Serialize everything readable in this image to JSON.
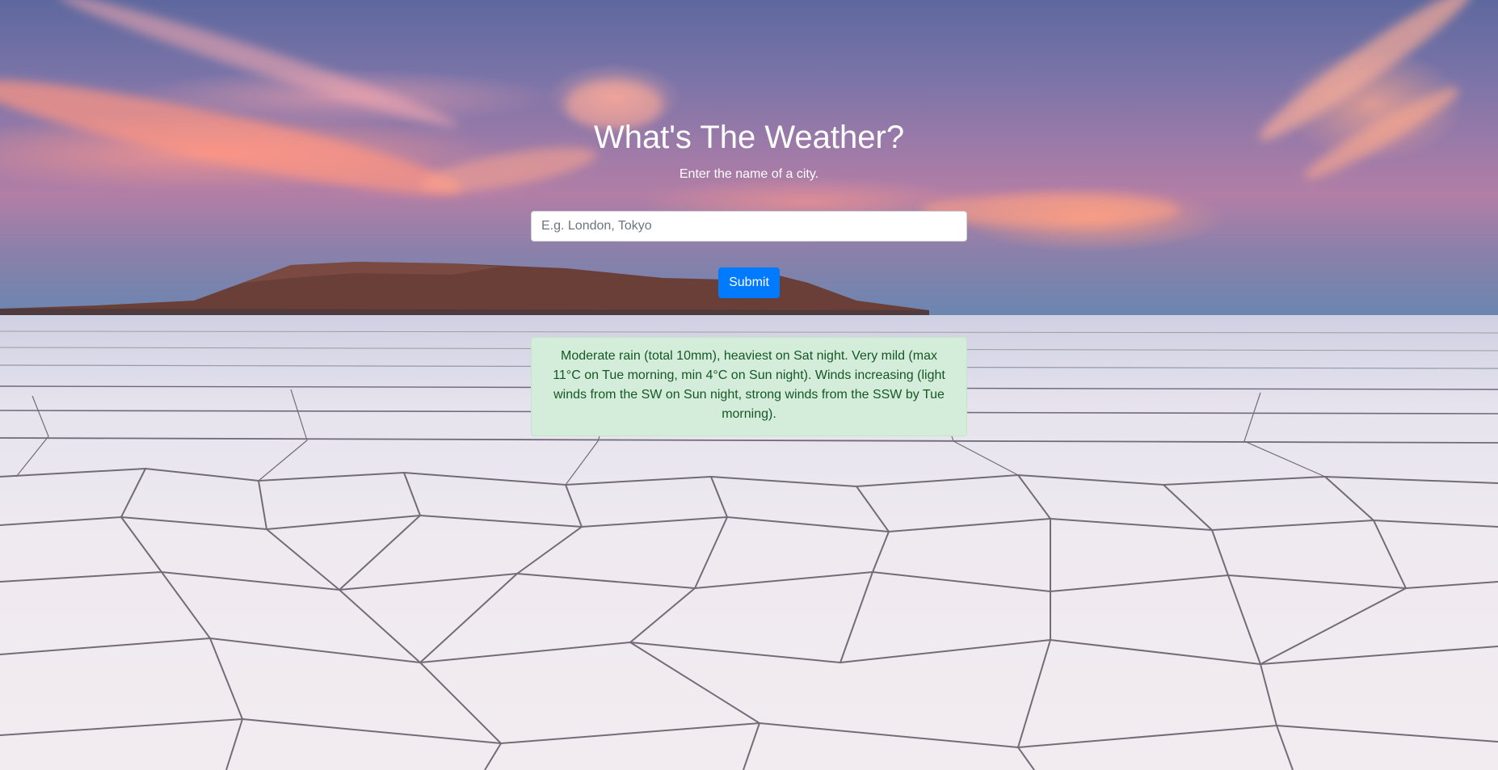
{
  "header": {
    "title": "What's The Weather?",
    "subtitle": "Enter the name of a city."
  },
  "form": {
    "city_placeholder": "E.g. London, Tokyo",
    "city_value": "",
    "submit_label": "Submit"
  },
  "result": {
    "forecast": "Moderate rain (total 10mm), heaviest on Sat night. Very mild (max 11°C on Tue morning, min 4°C on Sun night). Winds increasing (light winds from the SW on Sun night, strong winds from the SSW by Tue morning)."
  },
  "colors": {
    "primary": "#007bff",
    "alert_bg": "#d4edda",
    "alert_text": "#155724"
  }
}
